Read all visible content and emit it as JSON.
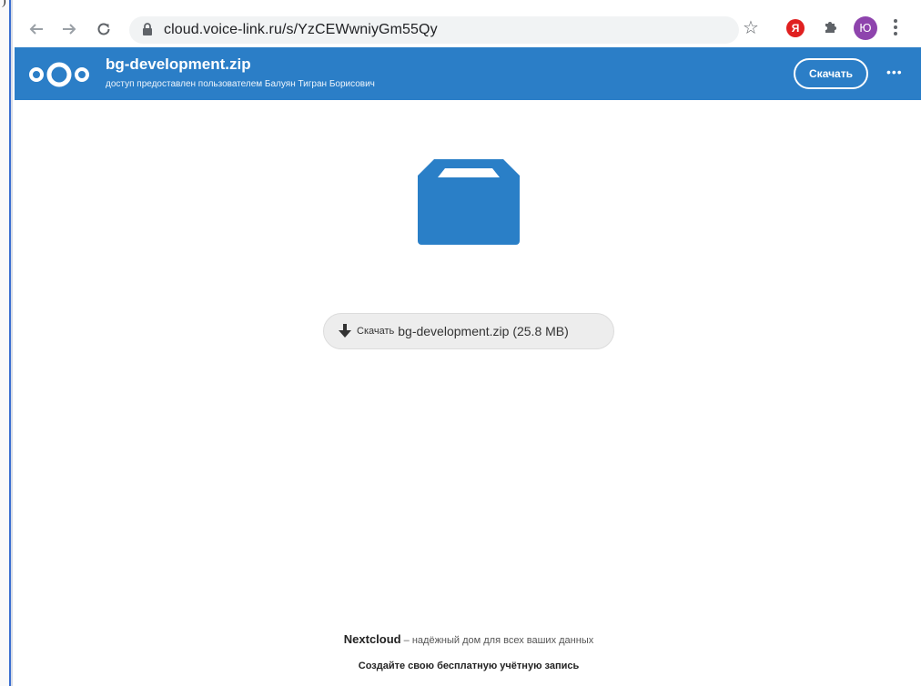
{
  "stray_char": ")",
  "browser": {
    "url": "cloud.voice-link.ru/s/YzCEWwniyGm55Qy",
    "extension_letter": "Я",
    "profile_letter": "Ю"
  },
  "header": {
    "file_name": "bg-development.zip",
    "shared_by": "доступ предоставлен пользователем Балуян Тигран Борисович",
    "download_label": "Скачать",
    "more_label": "•••"
  },
  "main": {
    "download_word": "Скачать",
    "download_file": "bg-development.zip (25.8 MB)"
  },
  "footer": {
    "brand": "Nextcloud",
    "tagline": " – надёжный дом для всех ваших данных",
    "signup": "Создайте свою бесплатную учётную запись"
  },
  "colors": {
    "brand_blue": "#2b7ec7",
    "folder_blue": "#2a7fc7"
  }
}
